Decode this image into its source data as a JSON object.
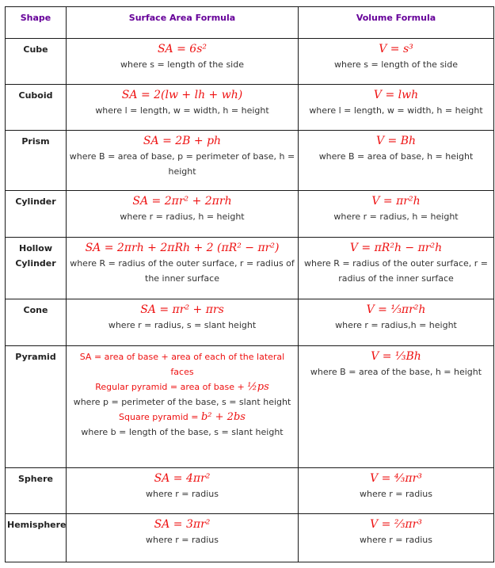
{
  "header": {
    "shape": "Shape",
    "surface_area": "Surface Area Formula",
    "volume": "Volume Formula"
  },
  "colors": {
    "header_text": "#660099",
    "formula": "#ee1111",
    "body_text": "#333333",
    "border": "#1a1a1a"
  },
  "rows": [
    {
      "shape": "Cube",
      "sa_formula": "SA = 6s²",
      "sa_desc": "where s = length of the side",
      "v_formula": "V = s³",
      "v_desc": "where s = length of the side"
    },
    {
      "shape": "Cuboid",
      "sa_formula": "SA = 2(lw + lh + wh)",
      "sa_desc": "where l = length, w = width, h = height",
      "v_formula": "V = lwh",
      "v_desc": "where l = length, w = width, h = height"
    },
    {
      "shape": "Prism",
      "sa_formula": "SA = 2B + ph",
      "sa_desc": "where B = area of base, p = perimeter of base, h = height",
      "v_formula": "V = Bh",
      "v_desc": "where B = area of base, h = height"
    },
    {
      "shape": "Cylinder",
      "sa_formula": "SA = 2πr² + 2πrh",
      "sa_desc": "where r = radius, h = height",
      "v_formula": "V = πr²h",
      "v_desc": "where r = radius, h = height"
    },
    {
      "shape": "Hollow Cylinder",
      "sa_formula": "SA = 2πrh + 2πRh + 2 (πR² − πr²)",
      "sa_desc": "where R = radius of the outer surface, r = radius of the inner surface",
      "v_formula": "V = πR²h − πr²h",
      "v_desc": "where R = radius of the outer surface, r = radius of the inner surface"
    },
    {
      "shape": "Cone",
      "sa_formula": "SA = πr² + πrs",
      "sa_desc": "where r = radius, s = slant height",
      "v_formula": "V = ⅓πr²h",
      "v_desc": "where r = radius,h = height"
    },
    {
      "shape": "Pyramid",
      "sa_line1": "SA = area of base + area of each of the lateral faces",
      "sa_line2_label": "Regular pyramid = area of base + ",
      "sa_line2_math": "½ps",
      "sa_line3": "where p = perimeter of the base, s = slant height",
      "sa_line4_label": "Square pyramid = ",
      "sa_line4_math": "b² + 2bs",
      "sa_line5": "where b = length of the base, s = slant height",
      "v_formula": "V = ⅓Bh",
      "v_desc": "where B = area of the base, h = height"
    },
    {
      "shape": "Sphere",
      "sa_formula": "SA = 4πr²",
      "sa_desc": "where r = radius",
      "v_formula": "V = ⁴⁄₃πr³",
      "v_desc": "where r = radius"
    },
    {
      "shape": "Hemisphere",
      "sa_formula": "SA = 3πr²",
      "sa_desc": "where r = radius",
      "v_formula": "V = ⅔πr³",
      "v_desc": "where r = radius"
    }
  ]
}
